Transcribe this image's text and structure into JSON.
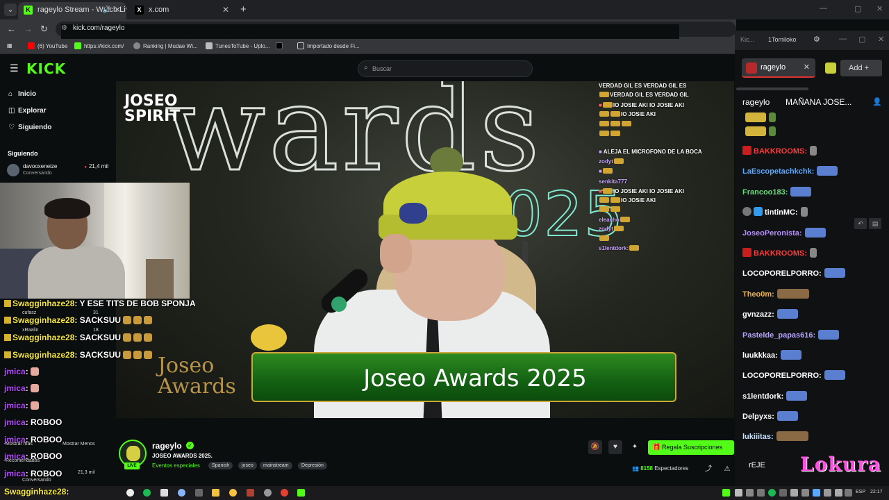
{
  "browser": {
    "tabs": [
      {
        "title": "rageylo Stream - Watch Liv",
        "active": true
      },
      {
        "title": "x.com",
        "active": false
      }
    ],
    "url": "kick.com/rageylo",
    "bookmarks": [
      "(6) YouTube",
      "https://kick.com/",
      "Ranking | Mudae Wi...",
      "TunesToTube - Uplo...",
      "Importado desde Fi..."
    ]
  },
  "header": {
    "logo": "KICK",
    "search_placeholder": "Buscar"
  },
  "sidebar": {
    "nav": [
      {
        "label": "Inicio",
        "icon": "home-icon"
      },
      {
        "label": "Explorar",
        "icon": "compass-icon"
      },
      {
        "label": "Siguiendo",
        "icon": "heart-icon"
      }
    ],
    "following_title": "Siguiendo",
    "following": [
      {
        "name": "davooxeneize",
        "sub": "Conversando",
        "viewers": "21,4 mil"
      }
    ]
  },
  "overlay_chat": {
    "lines": [
      {
        "user": "Swagginhaze28",
        "text": ": Y ESE TITS DE BOB SPONJA",
        "color": "yellow"
      },
      {
        "user": "Swagginhaze28",
        "text": ": SACKSUU",
        "color": "yellow"
      },
      {
        "user": "Swagginhaze28",
        "text": ": SACKSUU",
        "color": "yellow"
      },
      {
        "user": "Swagginhaze28",
        "text": ": SACKSUU",
        "color": "yellow"
      },
      {
        "user": "jmica",
        "text": ":",
        "color": "purple"
      },
      {
        "user": "jmica",
        "text": ":",
        "color": "purple"
      },
      {
        "user": "jmica",
        "text": ":",
        "color": "purple"
      },
      {
        "user": "jmica",
        "text": ": ROBOO",
        "color": "purple"
      },
      {
        "user": "jmica",
        "text": ": ROBOO",
        "color": "purple"
      },
      {
        "user": "jmica",
        "text": ": ROBOO",
        "color": "purple"
      },
      {
        "user": "jmica",
        "text": ": ROBOO",
        "color": "purple"
      },
      {
        "user": "Swagginhaze28",
        "text": ":",
        "color": "yellow"
      }
    ],
    "tiny": [
      "cufasz",
      "31",
      "xRaalin",
      "18",
      "Mostrar más",
      "Mostrar Menos",
      "Recomendados",
      "Conversando",
      "21,3 mil"
    ]
  },
  "video": {
    "big_text": "wards",
    "year": "2025",
    "logo_lines": "JOSEO\nSPIRIT",
    "bottom_logo": "Joseo\nAwards",
    "banner": "Joseo Awards 2025",
    "chat_lines": [
      "VERDAD GIL  ES VERDAD GIL  ES",
      "VERDAD GIL  ES VERDAD GIL",
      "IO JOSIE AKI  IO JOSIE AKI",
      "IO JOSIE AKI",
      "ALEJA EL MICROFONO DE LA BOCA",
      "IO JOSIE AKI  IO JOSIE AKI",
      "IO JOSIE AKI"
    ],
    "chat_names": [
      "zodyt",
      "senkita777",
      "eleacho",
      "zodyt",
      "s1lentdork:"
    ]
  },
  "stream": {
    "channel": "rageylo",
    "live": "LIVE",
    "title": "JOSEO AWARDS 2025.",
    "category": "Eventos especiales",
    "tags": [
      "Spanish",
      "joseo",
      "mainstream",
      "Depresión"
    ],
    "subscribe_label": "Regala Suscripciones",
    "viewer_count": "8158",
    "viewers_label": "Espectadores"
  },
  "chat_window": {
    "title_left": "Kic...",
    "title_user": "1Tomiloko",
    "tab_name": "rageylo",
    "add_label": "Add",
    "header_name": "rageylo",
    "header_pinned": "MAÑANA JOSE...",
    "messages": [
      {
        "user": "BAKKROOMS:",
        "color": "red",
        "badge": "red"
      },
      {
        "user": "LaEscopetachkchk:",
        "color": "blue"
      },
      {
        "user": "Francoo183:",
        "color": "green"
      },
      {
        "user": "tintinMC:",
        "color": "white",
        "badge": "gray"
      },
      {
        "user": "JoseoPeronista:",
        "color": "purple"
      },
      {
        "user": "BAKKROOMS:",
        "color": "red",
        "badge": "red"
      },
      {
        "user": "LOCOPORELPORRO:",
        "color": "white"
      },
      {
        "user": "Theo0m:",
        "color": "orange"
      },
      {
        "user": "gvnzazz:",
        "color": "white"
      },
      {
        "user": "Pastelde_papas616:",
        "color": "lightpurple"
      },
      {
        "user": "luukkkaa:",
        "color": "white"
      },
      {
        "user": "LOCOPORELPORRO:",
        "color": "white"
      },
      {
        "user": "s1lentdork:",
        "color": "white"
      },
      {
        "user": "Delpyxs:",
        "color": "white"
      },
      {
        "user": "lukiiitas:",
        "color": "teal"
      }
    ],
    "input_value": "rEJE",
    "overlay_word": "Lokura"
  },
  "taskbar": {
    "lang": "ESP",
    "time": "22:17"
  }
}
